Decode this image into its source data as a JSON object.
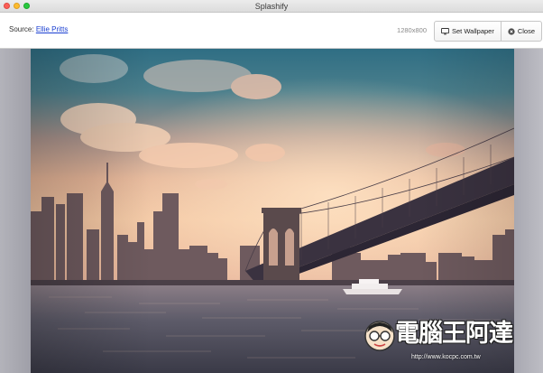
{
  "window": {
    "title": "Splashify"
  },
  "toolbar": {
    "source_label": "Source:",
    "source_author": "Ellie Pritts",
    "resolution": "1280x800",
    "set_wallpaper_label": "Set Wallpaper",
    "close_label": "Close"
  },
  "watermark": {
    "text": "電腦王阿達",
    "url": "http://www.kocpc.com.tw"
  },
  "colors": {
    "link": "#1a3fd1",
    "close_dot": "#fc5f57",
    "min_dot": "#fdbc2e",
    "max_dot": "#29c840"
  }
}
